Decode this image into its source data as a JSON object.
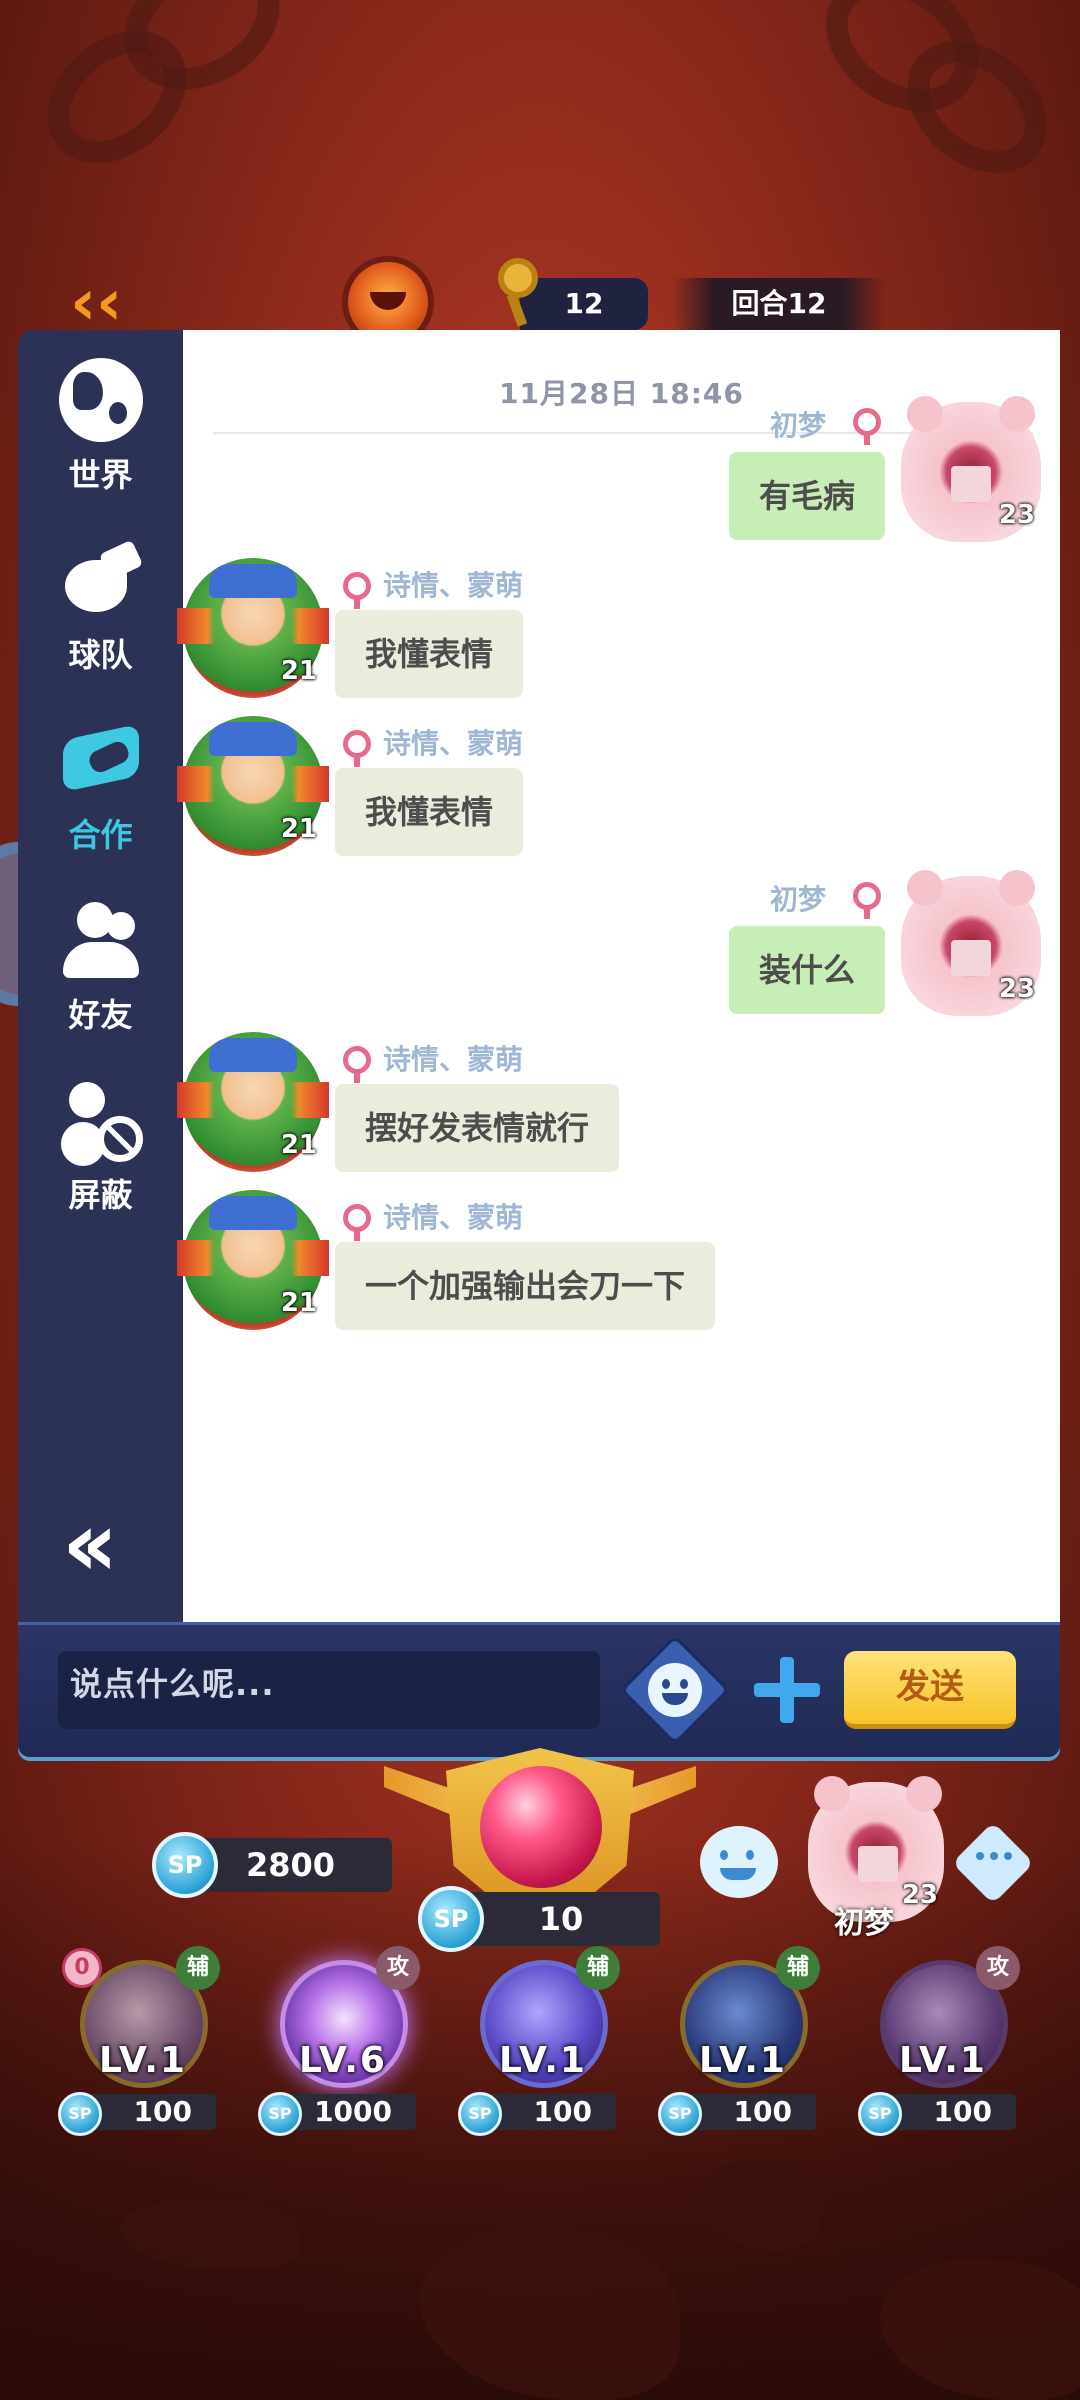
{
  "hud": {
    "keys_count": "12",
    "round_label": "回合12"
  },
  "sidebar": {
    "items": [
      {
        "label": "世界",
        "icon": "globe-icon"
      },
      {
        "label": "球队",
        "icon": "whistle-icon"
      },
      {
        "label": "合作",
        "icon": "handshake-icon",
        "active": true
      },
      {
        "label": "好友",
        "icon": "friends-icon"
      },
      {
        "label": "屏蔽",
        "icon": "block-user-icon"
      }
    ],
    "collapse_icon": "double-chevron-left-icon"
  },
  "chat": {
    "timestamp": "11月28日 18:46",
    "messages": [
      {
        "side": "right",
        "sender": "初梦",
        "level": "23",
        "text": "有毛病"
      },
      {
        "side": "left",
        "sender": "诗情、蒙萌",
        "level": "21",
        "text": "我懂表情"
      },
      {
        "side": "left",
        "sender": "诗情、蒙萌",
        "level": "21",
        "text": "我懂表情"
      },
      {
        "side": "right",
        "sender": "初梦",
        "level": "23",
        "text": "装什么"
      },
      {
        "side": "left",
        "sender": "诗情、蒙萌",
        "level": "21",
        "text": "摆好发表情就行"
      },
      {
        "side": "left",
        "sender": "诗情、蒙萌",
        "level": "21",
        "text": "一个加强输出会刀一下"
      }
    ]
  },
  "input": {
    "placeholder": "说点什么呢...",
    "send_label": "发送"
  },
  "game": {
    "total_sp_badge": "SP",
    "total_sp": "2800",
    "current_sp_badge": "SP",
    "current_sp": "10",
    "player_name": "初梦",
    "player_level": "23",
    "zero_badge": "0",
    "skills": [
      {
        "tag": "辅",
        "level": "LV.1",
        "cost": "100"
      },
      {
        "tag": "攻",
        "level": "LV.6",
        "cost": "1000"
      },
      {
        "tag": "辅",
        "level": "LV.1",
        "cost": "100"
      },
      {
        "tag": "辅",
        "level": "LV.1",
        "cost": "100"
      },
      {
        "tag": "攻",
        "level": "LV.1",
        "cost": "100"
      }
    ],
    "sp_small": "SP"
  },
  "colors": {
    "sidebar_bg": "#2c3156",
    "active_tab": "#3ec9e3",
    "bubble_left": "#ececdc",
    "bubble_right": "#c8eeb7",
    "send_button": "#f7c428",
    "tag_support": "#3f7d3a",
    "tag_attack": "#8a5a6a"
  }
}
